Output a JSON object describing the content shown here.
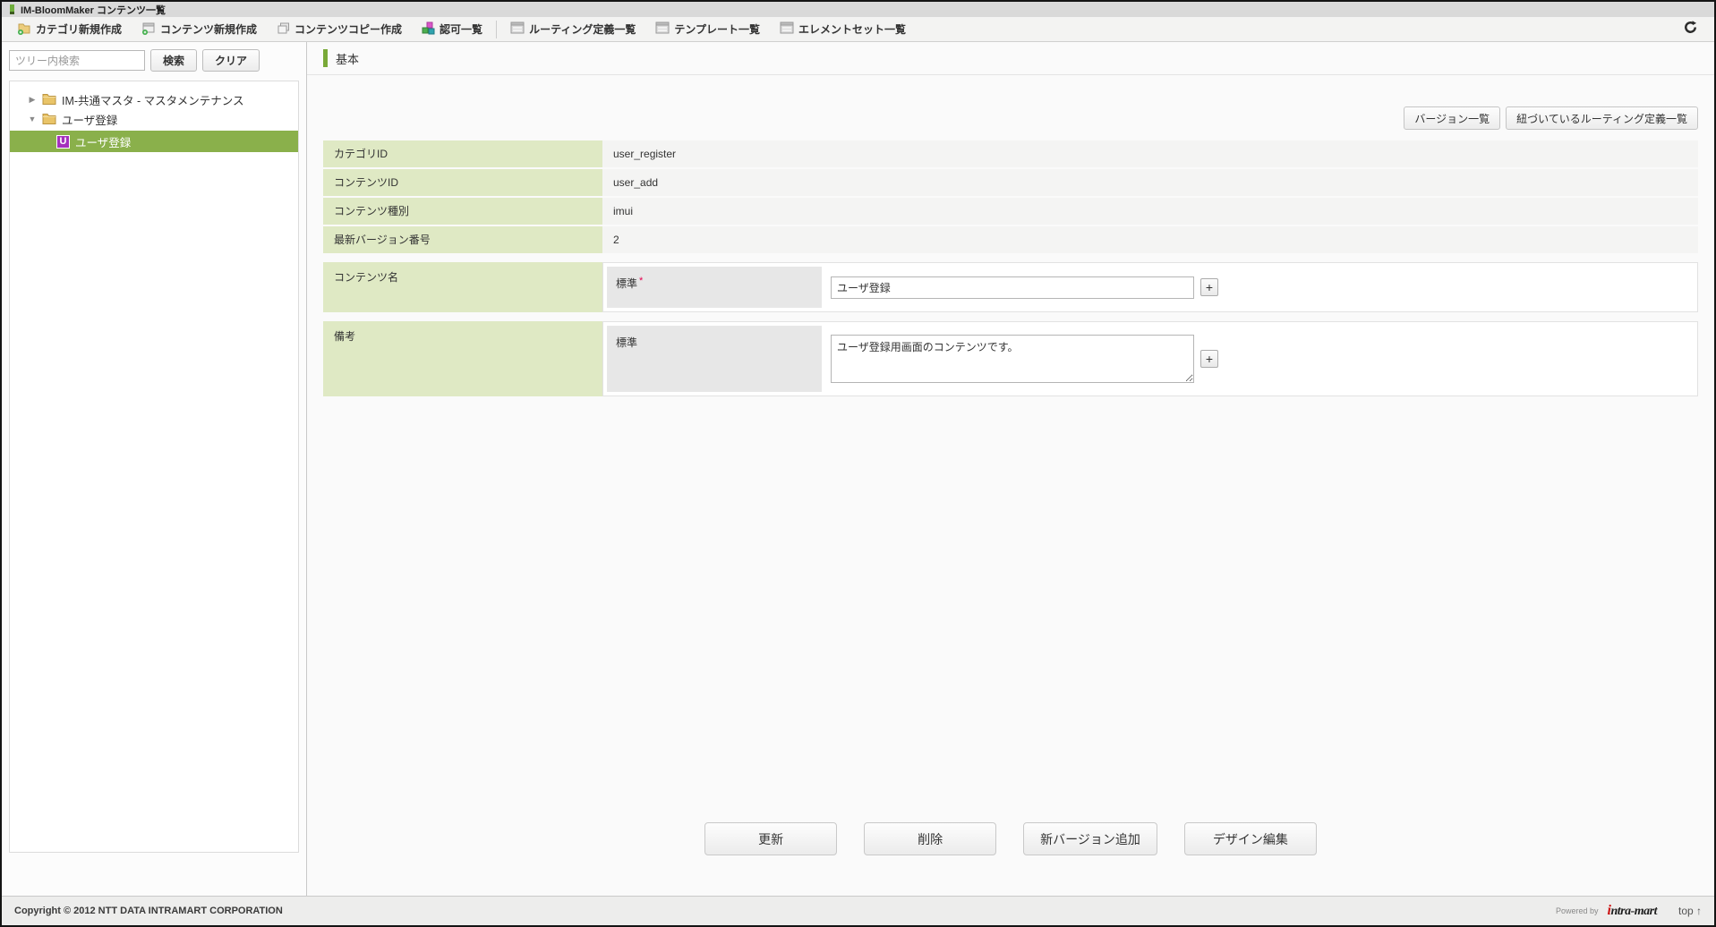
{
  "window": {
    "title": "IM-BloomMaker コンテンツ一覧"
  },
  "toolbar": {
    "items": [
      {
        "label": "カテゴリ新規作成",
        "icon": "folder-add-icon"
      },
      {
        "label": "コンテンツ新規作成",
        "icon": "content-add-icon"
      },
      {
        "label": "コンテンツコピー作成",
        "icon": "copy-icon"
      },
      {
        "label": "認可一覧",
        "icon": "authz-cubes-icon"
      },
      {
        "label": "ルーティング定義一覧",
        "icon": "list-icon"
      },
      {
        "label": "テンプレート一覧",
        "icon": "list-icon"
      },
      {
        "label": "エレメントセット一覧",
        "icon": "list-icon"
      }
    ],
    "refresh_icon": "refresh-icon"
  },
  "sidebar": {
    "search": {
      "placeholder": "ツリー内検索",
      "value": ""
    },
    "search_button": "検索",
    "clear_button": "クリア",
    "tree": [
      {
        "label": "IM-共通マスタ - マスタメンテナンス",
        "state": "collapsed",
        "level": 0
      },
      {
        "label": "ユーザ登録",
        "state": "expanded",
        "level": 0
      },
      {
        "label": "ユーザ登録",
        "state": "selected",
        "level": 1,
        "badge": "U"
      }
    ]
  },
  "main": {
    "section_title": "基本",
    "top_buttons": [
      "バージョン一覧",
      "紐づいているルーティング定義一覧"
    ],
    "info_rows": [
      {
        "label": "カテゴリID",
        "value": "user_register"
      },
      {
        "label": "コンテンツID",
        "value": "user_add"
      },
      {
        "label": "コンテンツ種別",
        "value": "imui"
      },
      {
        "label": "最新バージョン番号",
        "value": "2"
      }
    ],
    "name_row": {
      "label": "コンテンツ名",
      "sub_label": "標準",
      "required_mark": "*",
      "value": "ユーザ登録",
      "add_label": "+"
    },
    "note_row": {
      "label": "備考",
      "sub_label": "標準",
      "value": "ユーザ登録用画面のコンテンツです。",
      "add_label": "+"
    },
    "action_buttons": [
      "更新",
      "削除",
      "新バージョン追加",
      "デザイン編集"
    ]
  },
  "footer": {
    "copyright": "Copyright © 2012 NTT DATA INTRAMART CORPORATION",
    "powered_by": "Powered by",
    "brand": "intra-mart",
    "top_link": "top ↑"
  },
  "colors": {
    "accent_green": "#79a938",
    "selected_green": "#8ab04b",
    "label_green": "#dfe9c4",
    "badge_purple": "#a431bd",
    "required_red": "#e5004f",
    "brand_red": "#cc1111"
  }
}
